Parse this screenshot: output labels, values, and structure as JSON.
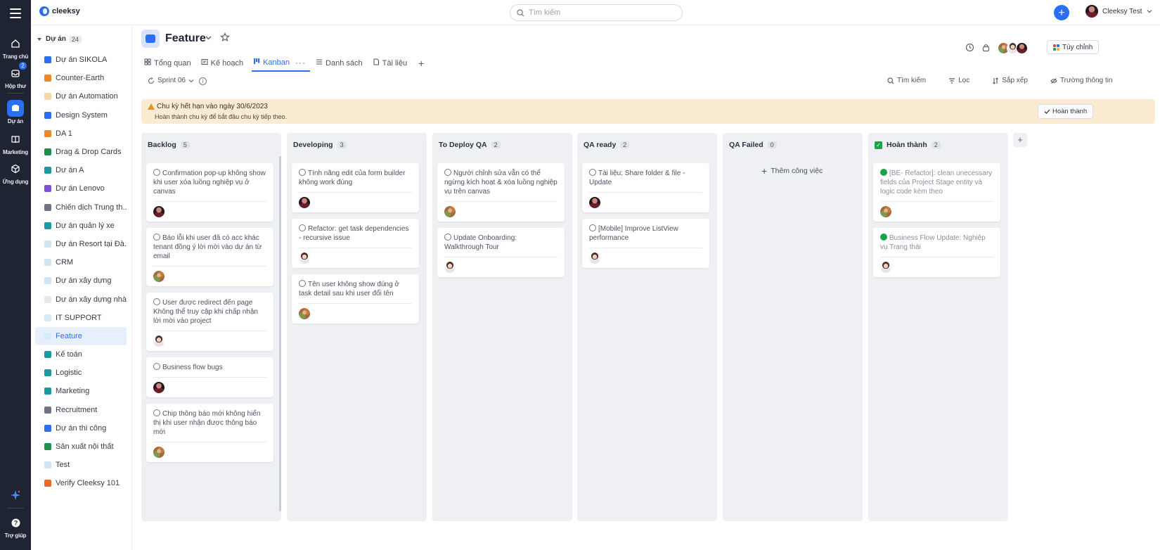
{
  "rail": {
    "items": [
      {
        "label": "Trang chủ",
        "icon": "home-icon"
      },
      {
        "label": "Hộp thư",
        "icon": "inbox-icon",
        "badge": "2"
      },
      {
        "label": "Dự án",
        "icon": "project-icon",
        "active": true
      },
      {
        "label": "Marketing",
        "icon": "book-icon"
      },
      {
        "label": "Ứng dụng",
        "icon": "apps-icon"
      }
    ],
    "help_label": "Trợ giúp"
  },
  "topbar": {
    "logo": "cleeksy",
    "search_placeholder": "Tìm kiếm",
    "user_name": "Cleeksy Test"
  },
  "sidebar": {
    "section_label": "Dự án",
    "section_count": "24",
    "projects": [
      {
        "name": "Dự án SIKOLA",
        "color": "#2b6ef2"
      },
      {
        "name": "Counter-Earth",
        "color": "#e8892b"
      },
      {
        "name": "Dự án Automation",
        "color": "#f3d7a8"
      },
      {
        "name": "Design System",
        "color": "#2b6ef2"
      },
      {
        "name": "DA 1",
        "color": "#e8892b"
      },
      {
        "name": "Drag & Drop Cards",
        "color": "#1f8f4e"
      },
      {
        "name": "Dự án A",
        "color": "#1a9aa0"
      },
      {
        "name": "Dự án Lenovo",
        "color": "#7b4fd6"
      },
      {
        "name": "Chiến dịch Trung th...",
        "color": "#6f7480"
      },
      {
        "name": "Dự án quản lý xe",
        "color": "#1a9aa0"
      },
      {
        "name": "Dự án Resort tại Đà...",
        "color": "#cfe6f2"
      },
      {
        "name": "CRM",
        "color": "#cfe6f2"
      },
      {
        "name": "Dự án xây dựng",
        "color": "#cfe6f2"
      },
      {
        "name": "Dự án xây dựng nhà...",
        "color": "#e6e8ec"
      },
      {
        "name": "IT SUPPORT",
        "color": "#d4ecf7"
      },
      {
        "name": "Feature",
        "color": "#d4ecf7",
        "active": true
      },
      {
        "name": "Kế toán",
        "color": "#1a9aa0"
      },
      {
        "name": "Logistic",
        "color": "#1a9aa0"
      },
      {
        "name": "Marketing",
        "color": "#1a9aa0"
      },
      {
        "name": "Recruitment",
        "color": "#6f7480"
      },
      {
        "name": "Dự án thi công",
        "color": "#2b6ef2"
      },
      {
        "name": "Sản xuất nội thất",
        "color": "#1f8f4e"
      },
      {
        "name": "Test",
        "color": "#cfe6f2"
      },
      {
        "name": "Verify Cleeksy 101",
        "color": "#e8692b"
      }
    ]
  },
  "project": {
    "title": "Feature",
    "tabs": [
      {
        "label": "Tổng quan",
        "icon": "grid-icon"
      },
      {
        "label": "Kế hoạch",
        "icon": "plan-icon"
      },
      {
        "label": "Kanban",
        "icon": "kanban-icon",
        "active": true
      },
      {
        "label": "Danh sách",
        "icon": "list-icon"
      },
      {
        "label": "Tài liệu",
        "icon": "doc-icon"
      }
    ],
    "customize_label": "Tùy chỉnh"
  },
  "toolbar": {
    "sprint": "Sprint 06",
    "search": "Tìm kiếm",
    "filter": "Lọc",
    "sort": "Sắp xếp",
    "fields": "Trường thông tin"
  },
  "banner": {
    "title": "Chu kỳ hết hạn vào ngày 30/6/2023",
    "subtitle": "Hoàn thành chu kỳ để bắt đầu chu kỳ tiếp theo.",
    "button": "Hoàn thành"
  },
  "board": {
    "add_task_label": "Thêm công việc",
    "columns": [
      {
        "name": "Backlog",
        "count": "5",
        "cards": [
          {
            "title": "Confirmation pop-up không show khi user xóa luồng nghiệp vụ ở canvas",
            "avatar": "dark"
          },
          {
            "title": "Báo lỗi khi user đã có acc khác tenant đồng ý lời mời vào dự án từ email",
            "avatar": "photo"
          },
          {
            "title": "User được redirect đến page Không thể truy cập khi chấp nhận lời mời vào project",
            "avatar": "light"
          },
          {
            "title": "Business flow bugs",
            "avatar": "dark"
          },
          {
            "title": "Chip thông báo mới không hiển thị khi user nhận được thông báo mới",
            "avatar": "photo"
          }
        ]
      },
      {
        "name": "Developing",
        "count": "3",
        "cards": [
          {
            "title": "Tính năng edit của form builder không work đúng",
            "avatar": "dark"
          },
          {
            "title": "Refactor: get task dependencies - recursive issue",
            "avatar": "light"
          },
          {
            "title": "Tên user không show đúng ở task detail sau khi user đổi tên",
            "avatar": "photo"
          }
        ]
      },
      {
        "name": "To Deploy QA",
        "count": "2",
        "cards": [
          {
            "title": "Người chỉnh sửa vẫn có thể ngừng kích hoạt & xóa luồng nghiệp vụ trên canvas",
            "avatar": "photo"
          },
          {
            "title": "Update Onboarding: Walkthrough Tour",
            "avatar": "light"
          }
        ]
      },
      {
        "name": "QA ready",
        "count": "2",
        "cards": [
          {
            "title": "Tài liệu: Share folder & file - Update",
            "avatar": "dark"
          },
          {
            "title": "[Mobile] Improve ListView performance",
            "avatar": "light"
          }
        ]
      },
      {
        "name": "QA Failed",
        "count": "0",
        "cards": []
      },
      {
        "name": "Hoàn thành",
        "count": "2",
        "done": true,
        "cards": [
          {
            "title": "[BE- Refactor]: clean unecessary fields của Project Stage entity và logic code kèm theo",
            "avatar": "photo"
          },
          {
            "title": "Business Flow Update: Nghiệp vụ Trạng thái",
            "avatar": "light"
          }
        ]
      }
    ]
  }
}
